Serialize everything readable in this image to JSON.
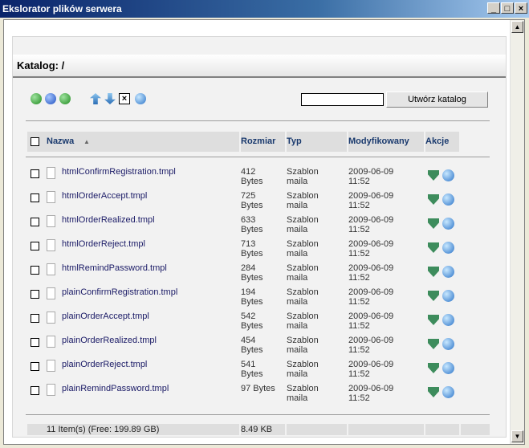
{
  "window": {
    "title": "Ekslorator plików serwera",
    "buttons": [
      "_",
      "□",
      "×"
    ]
  },
  "header": {
    "label": "Katalog: /"
  },
  "toolbar": {
    "icons": [
      "up-folder-icon",
      "home-icon",
      "refresh-icon",
      "upload-icon",
      "download-icon",
      "delete-icon",
      "web-icon"
    ],
    "input_value": "",
    "create_button": "Utwórz katalog"
  },
  "columns": {
    "name": "Nazwa",
    "sort": "▲",
    "size": "Rozmiar",
    "type": "Typ",
    "modified": "Modyfikowany",
    "actions": "Akcje"
  },
  "files": [
    {
      "name": "htmlConfirmRegistration.tmpl",
      "size": "412\nBytes",
      "type": "Szablon\nmaila",
      "date": "2009-06-09\n11:52"
    },
    {
      "name": "htmlOrderAccept.tmpl",
      "size": "725\nBytes",
      "type": "Szablon\nmaila",
      "date": "2009-06-09\n11:52"
    },
    {
      "name": "htmlOrderRealized.tmpl",
      "size": "633\nBytes",
      "type": "Szablon\nmaila",
      "date": "2009-06-09\n11:52"
    },
    {
      "name": "htmlOrderReject.tmpl",
      "size": "713\nBytes",
      "type": "Szablon\nmaila",
      "date": "2009-06-09\n11:52"
    },
    {
      "name": "htmlRemindPassword.tmpl",
      "size": "284\nBytes",
      "type": "Szablon\nmaila",
      "date": "2009-06-09\n11:52"
    },
    {
      "name": "plainConfirmRegistration.tmpl",
      "size": "194\nBytes",
      "type": "Szablon\nmaila",
      "date": "2009-06-09\n11:52"
    },
    {
      "name": "plainOrderAccept.tmpl",
      "size": "542\nBytes",
      "type": "Szablon\nmaila",
      "date": "2009-06-09\n11:52"
    },
    {
      "name": "plainOrderRealized.tmpl",
      "size": "454\nBytes",
      "type": "Szablon\nmaila",
      "date": "2009-06-09\n11:52"
    },
    {
      "name": "plainOrderReject.tmpl",
      "size": "541\nBytes",
      "type": "Szablon\nmaila",
      "date": "2009-06-09\n11:52"
    },
    {
      "name": "plainRemindPassword.tmpl",
      "size": "97 Bytes",
      "type": "Szablon\nmaila",
      "date": "2009-06-09\n11:52"
    }
  ],
  "footer": {
    "items": "11 Item(s) (Free: 199.89 GB)",
    "total": "8.49 KB"
  },
  "colors": {
    "title_start": "#0a246a",
    "header_text": "#1a3a6e",
    "link_text": "#1a1a66",
    "panel_bg": "#f2f2f2"
  }
}
